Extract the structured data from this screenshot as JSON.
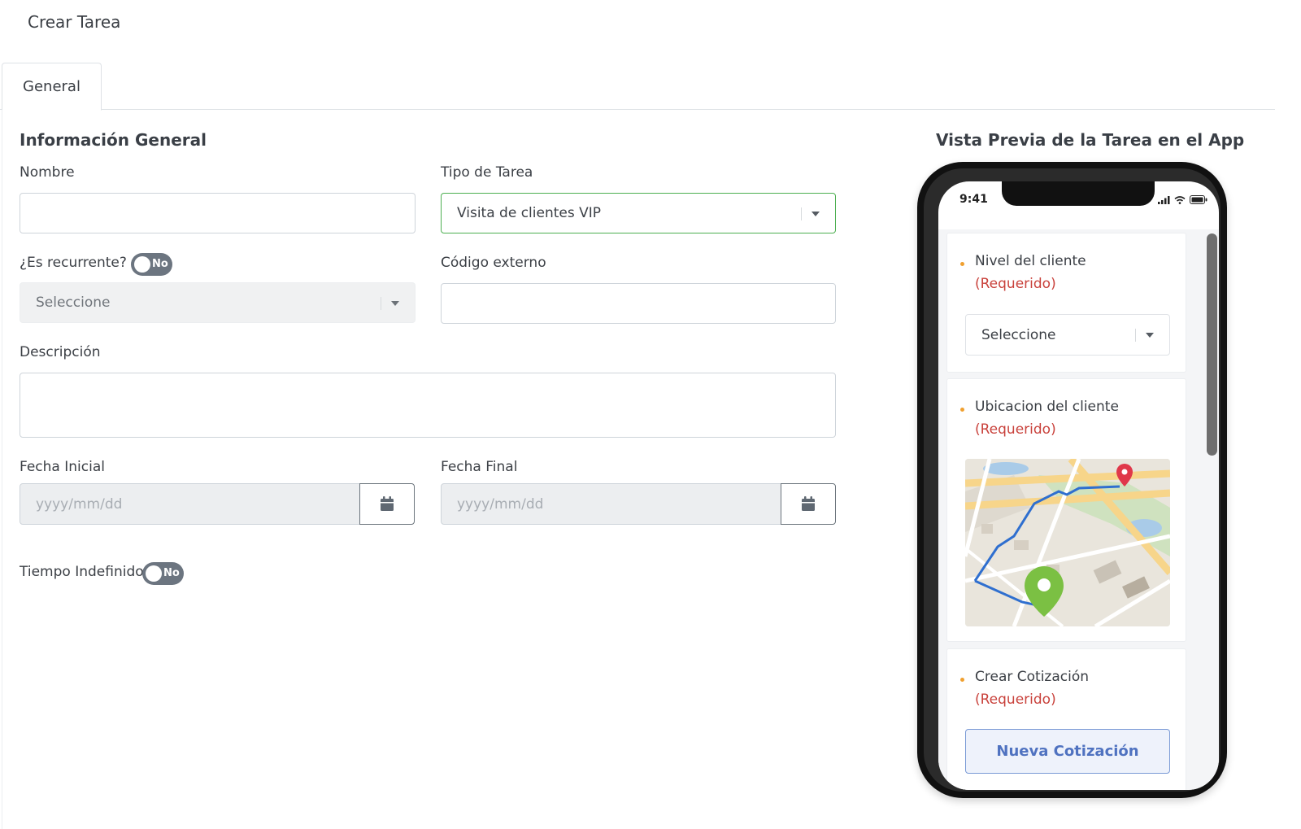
{
  "page": {
    "title": "Crear Tarea"
  },
  "tabs": [
    {
      "label": "General"
    }
  ],
  "form": {
    "section_title": "Información General",
    "nombre": {
      "label": "Nombre",
      "value": ""
    },
    "tipo_tarea": {
      "label": "Tipo de Tarea",
      "value": "Visita de clientes VIP"
    },
    "recurrente": {
      "label": "¿Es recurrente?",
      "toggle": "No",
      "select_value": "Seleccione"
    },
    "codigo_externo": {
      "label": "Código externo",
      "value": ""
    },
    "descripcion": {
      "label": "Descripción",
      "value": ""
    },
    "fecha_inicial": {
      "label": "Fecha Inicial",
      "placeholder": "yyyy/mm/dd"
    },
    "fecha_final": {
      "label": "Fecha Final",
      "placeholder": "yyyy/mm/dd"
    },
    "tiempo_indefinido": {
      "label": "Tiempo Indefinido",
      "toggle": "No"
    }
  },
  "preview": {
    "title": "Vista Previa de la Tarea en el App",
    "status_time": "9:41",
    "cards": {
      "nivel": {
        "title": "Nivel del cliente",
        "required": "(Requerido)",
        "select_value": "Seleccione"
      },
      "ubicacion": {
        "title": "Ubicacion del cliente",
        "required": "(Requerido)"
      },
      "cotizacion": {
        "title": "Crear Cotización",
        "required": "(Requerido)",
        "button": "Nueva Cotización"
      }
    }
  },
  "colors": {
    "accent_green": "#4caf50",
    "toggle_off": "#6c7580",
    "required_red": "#c9423c",
    "bullet_orange": "#f0a030",
    "button_blue": "#4f72c0"
  },
  "icons": [
    "calendar-icon",
    "caret-down-icon",
    "signal-icon",
    "wifi-icon",
    "battery-icon",
    "map-pin-icon"
  ]
}
